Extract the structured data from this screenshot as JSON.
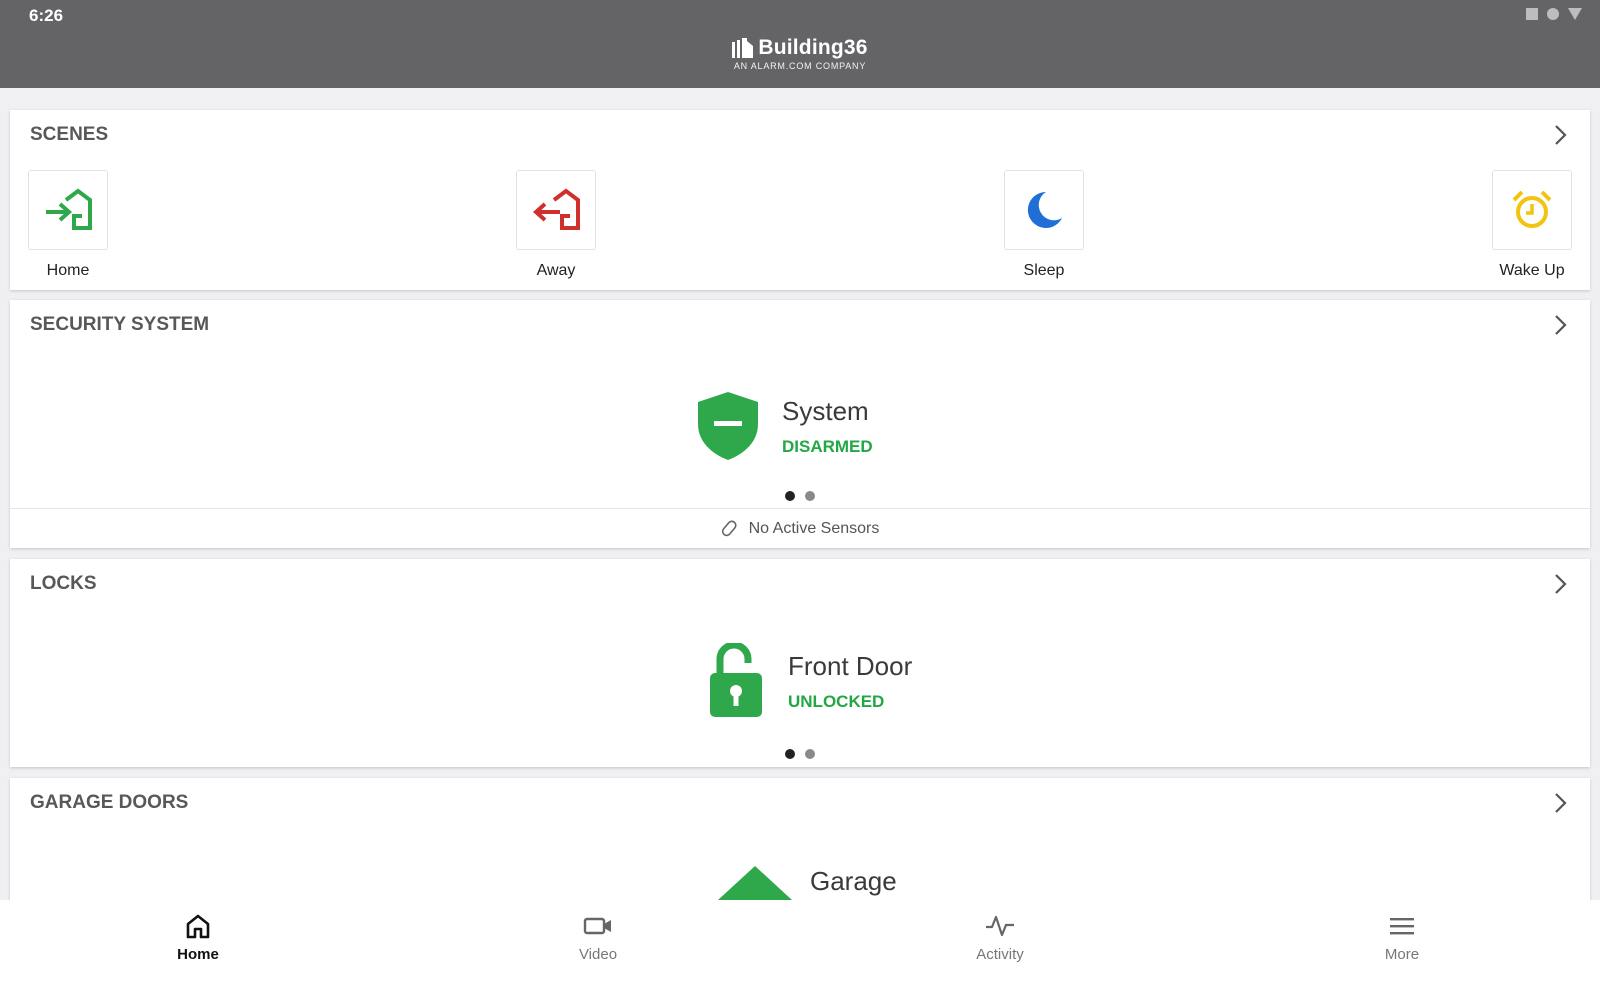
{
  "status_bar": {
    "time": "6:26"
  },
  "header": {
    "brand_name": "Building36",
    "brand_subtitle": "AN ALARM.COM COMPANY"
  },
  "scenes": {
    "title": "SCENES",
    "items": [
      {
        "label": "Home",
        "icon": "home-arrive-icon",
        "color": "#2ea84a"
      },
      {
        "label": "Away",
        "icon": "home-leave-icon",
        "color": "#d0302b"
      },
      {
        "label": "Sleep",
        "icon": "moon-icon",
        "color": "#1f6fd6"
      },
      {
        "label": "Wake Up",
        "icon": "alarm-clock-icon",
        "color": "#f2c40f"
      }
    ]
  },
  "security": {
    "title": "SECURITY SYSTEM",
    "name": "System",
    "state": "DISARMED",
    "state_color": "#22a745",
    "sensors": "No Active Sensors",
    "page": 1,
    "pages": 2
  },
  "locks": {
    "title": "LOCKS",
    "name": "Front Door",
    "state": "UNLOCKED",
    "page": 1,
    "pages": 2
  },
  "garage": {
    "title": "GARAGE DOORS",
    "name": "Garage"
  },
  "nav": {
    "items": [
      {
        "label": "Home",
        "icon": "home-icon",
        "active": true
      },
      {
        "label": "Video",
        "icon": "video-camera-icon",
        "active": false
      },
      {
        "label": "Activity",
        "icon": "activity-pulse-icon",
        "active": false
      },
      {
        "label": "More",
        "icon": "menu-icon",
        "active": false
      }
    ]
  }
}
